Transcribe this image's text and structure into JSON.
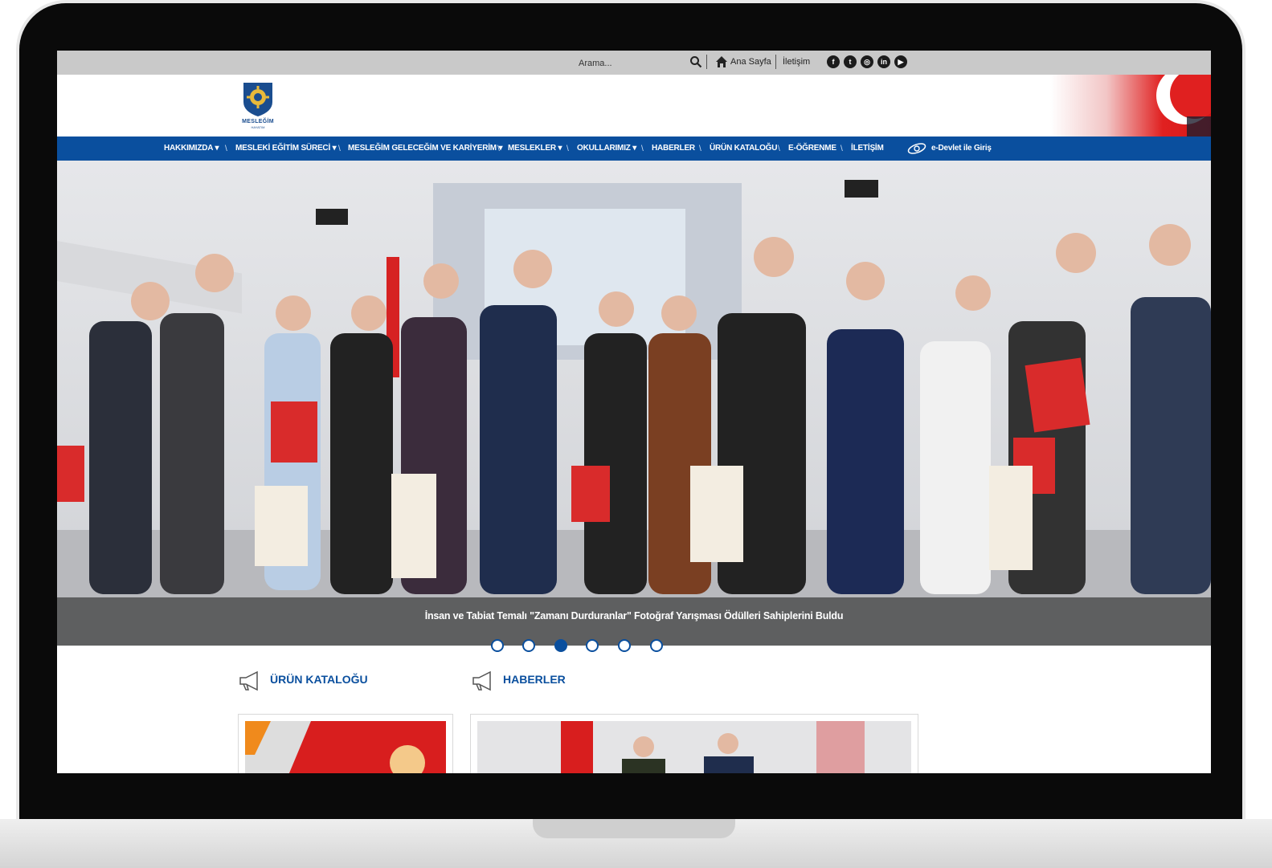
{
  "topbar": {
    "search_placeholder": "Arama...",
    "home_label": "Ana Sayfa",
    "contact_label": "İletişim",
    "social_icons": [
      "facebook-icon",
      "twitter-icon",
      "instagram-icon",
      "linkedin-icon",
      "youtube-icon"
    ]
  },
  "header": {
    "logo_text": "MESLEĞİM",
    "logo_subtext": "HAYATIM"
  },
  "nav": {
    "items": [
      "HAKKIMIZDA",
      "MESLEKİ EĞİTİM SÜRECİ",
      "MESLEĞİM GELECEĞİM VE KARİYERİM",
      "MESLEKLER",
      "OKULLARIMIZ",
      "HABERLER",
      "ÜRÜN KATALOĞU",
      "E-ÖĞRENME",
      "İLETİŞİM"
    ],
    "edevlet_label": "e-Devlet ile Giriş"
  },
  "slider": {
    "caption": "İnsan ve Tabiat Temalı \"Zamanı Durduranlar\" Fotoğraf Yarışması Ödülleri Sahiplerini Buldu",
    "dot_count": 6,
    "active_dot": 3
  },
  "sections": {
    "catalog_title": "ÜRÜN KATALOĞU",
    "news_title": "HABERLER"
  },
  "colors": {
    "nav_blue": "#0a4f9e",
    "topbar_gray": "#c9c9c9",
    "flag_red": "#e02020"
  }
}
